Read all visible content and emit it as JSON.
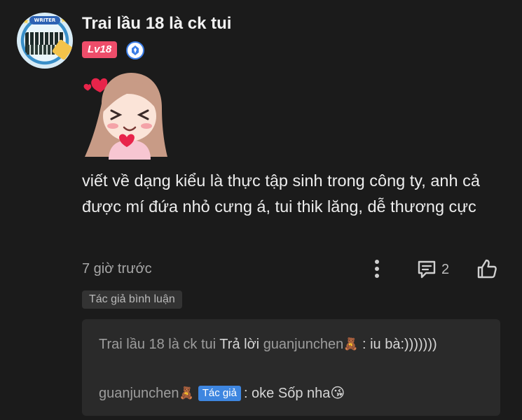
{
  "comment": {
    "username": "Trai lầu 18 là ck tui",
    "avatar_banner": "WRITER",
    "level_badge": "Lv18",
    "text": "viết về dạng kiểu là thực tập sinh trong công ty, anh cả được mí đứa nhỏ cưng á, tui thik lăng, dễ thương cực",
    "timestamp": "7 giờ trước",
    "reply_count": "2",
    "author_tag": "Tác giả bình luận",
    "icons": {
      "rank": "rank-badge-icon",
      "more": "more-vertical-icon",
      "reply": "comment-bubble-icon",
      "like": "thumbs-up-icon"
    }
  },
  "replies": [
    {
      "author": "Trai lầu 18 là ck tui",
      "action": " Trả lời ",
      "target": "guanjunchen",
      "emoji": "🧸",
      "text": " : iu bà:)))))))"
    },
    {
      "author": "guanjunchen",
      "emoji": "🧸",
      "author_chip": "Tác giả",
      "text": ": oke Sốp nha😘"
    }
  ],
  "colors": {
    "background": "#1b1b1b",
    "level_badge": "#ee4d6a",
    "author_chip": "#3e86e0",
    "reply_box": "#2a2a2a"
  }
}
